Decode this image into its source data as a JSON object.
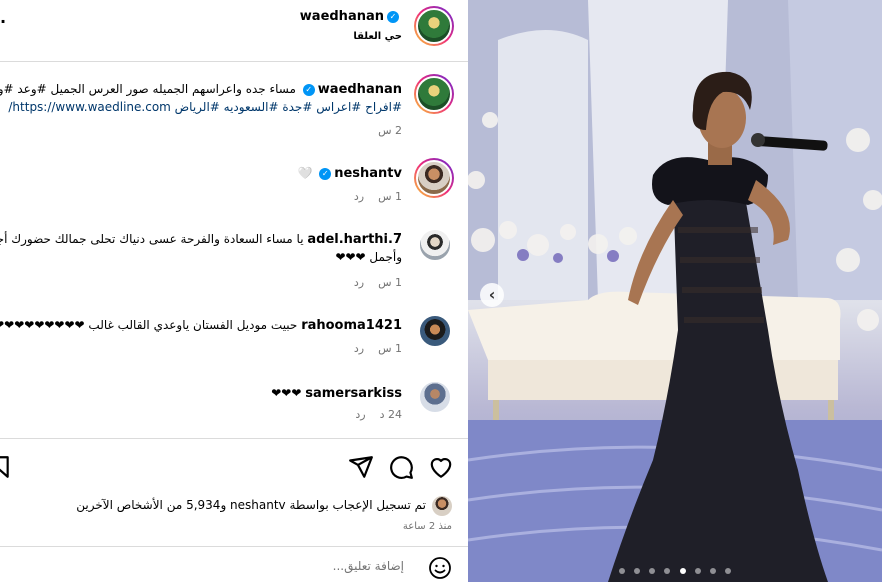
{
  "header": {
    "username": "waedhanan",
    "subtitle": "حي العلقا",
    "more": "."
  },
  "caption": {
    "username": "waedhanan",
    "line1": "مساء جده واعراسهم الجميله صور العرس الجميل #وعد #وعدلاين",
    "line2": "#افراح #اعراس #جدة #السعوديه #الرياض https://www.waedline.com/",
    "time": "2 س"
  },
  "comments": [
    {
      "username": "neshantv",
      "verified": true,
      "text": "🤍",
      "time": "1 س",
      "reply": "رد"
    },
    {
      "username": "adel.harthi.7",
      "verified": false,
      "text": "يا مساء السعادة والفرحة عسى دنياك تحلى جمالك حضورك أجمل",
      "text2": "وأجمل ❤❤❤",
      "time": "1 س",
      "reply": "رد"
    },
    {
      "username": "rahooma1421",
      "verified": false,
      "text": "حبيت موديل الفستان ياوعدي القالب غالب ❤❤❤❤❤❤❤❤❤❤",
      "time": "1 س",
      "reply": "رد"
    },
    {
      "username": "samersarkiss",
      "verified": false,
      "text": "❤❤❤",
      "time": "24 د",
      "reply": "رد"
    }
  ],
  "likes": {
    "text": "تم تسجيل الإعجاب بواسطة neshantv و5,934 من الأشخاص الآخرين",
    "time": "منذ 2 ساعة"
  },
  "add_comment": {
    "placeholder": "إضافة تعليق..."
  },
  "photo": {
    "prev": "‹"
  }
}
